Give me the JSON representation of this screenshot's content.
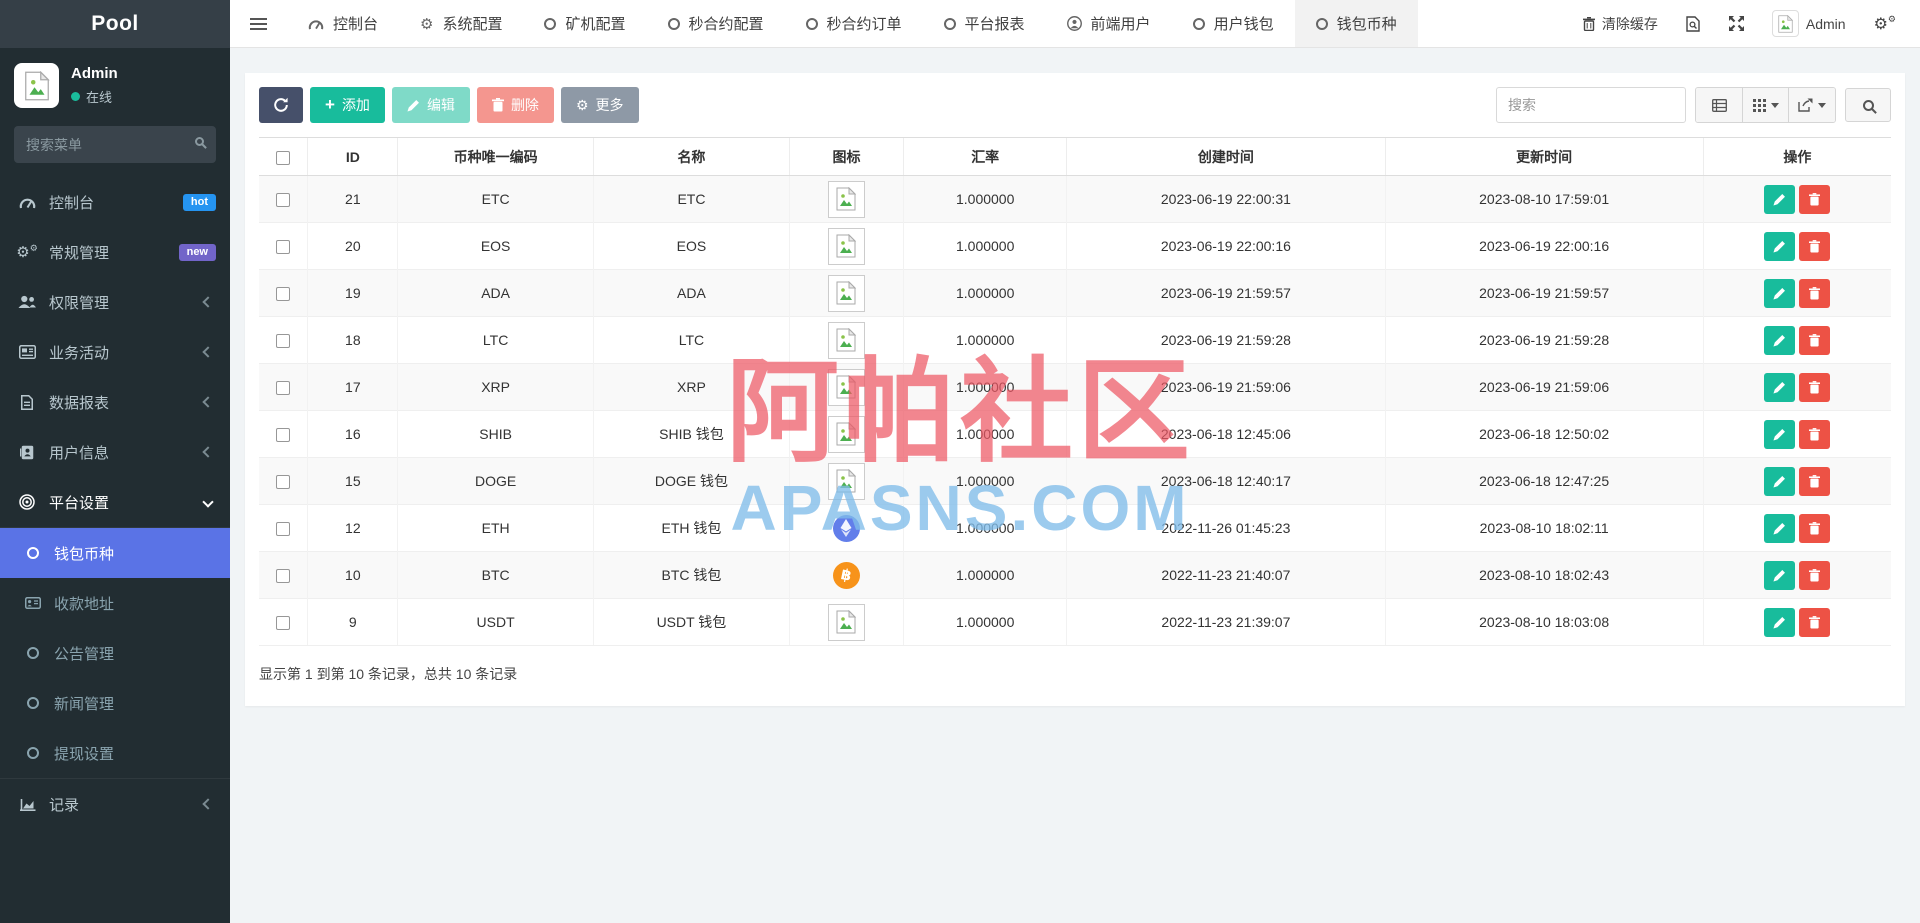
{
  "sidebar": {
    "logo": "Pool",
    "user": {
      "name": "Admin",
      "status": "在线"
    },
    "search_placeholder": "搜索菜单",
    "items": [
      {
        "label": "控制台",
        "badge": "hot"
      },
      {
        "label": "常规管理",
        "badge": "new"
      },
      {
        "label": "权限管理"
      },
      {
        "label": "业务活动"
      },
      {
        "label": "数据报表"
      },
      {
        "label": "用户信息"
      },
      {
        "label": "平台设置"
      },
      {
        "label": "记录"
      }
    ],
    "platform_submenu": [
      {
        "label": "钱包币种",
        "active": true
      },
      {
        "label": "收款地址"
      },
      {
        "label": "公告管理"
      },
      {
        "label": "新闻管理"
      },
      {
        "label": "提现设置"
      }
    ]
  },
  "topnav": {
    "tabs": [
      {
        "label": "控制台"
      },
      {
        "label": "系统配置"
      },
      {
        "label": "矿机配置"
      },
      {
        "label": "秒合约配置"
      },
      {
        "label": "秒合约订单"
      },
      {
        "label": "平台报表"
      },
      {
        "label": "前端用户"
      },
      {
        "label": "用户钱包"
      },
      {
        "label": "钱包币种",
        "active": true
      }
    ],
    "clear_cache": "清除缓存",
    "username": "Admin"
  },
  "toolbar": {
    "add": "添加",
    "edit": "编辑",
    "delete": "删除",
    "more": "更多",
    "search_placeholder": "搜索"
  },
  "table": {
    "headers": [
      "ID",
      "币种唯一编码",
      "名称",
      "图标",
      "汇率",
      "创建时间",
      "更新时间",
      "操作"
    ],
    "rows": [
      {
        "id": "21",
        "code": "ETC",
        "name": "ETC",
        "icon": "broken",
        "rate": "1.000000",
        "created": "2023-06-19 22:00:31",
        "updated": "2023-08-10 17:59:01"
      },
      {
        "id": "20",
        "code": "EOS",
        "name": "EOS",
        "icon": "broken",
        "rate": "1.000000",
        "created": "2023-06-19 22:00:16",
        "updated": "2023-06-19 22:00:16"
      },
      {
        "id": "19",
        "code": "ADA",
        "name": "ADA",
        "icon": "broken",
        "rate": "1.000000",
        "created": "2023-06-19 21:59:57",
        "updated": "2023-06-19 21:59:57"
      },
      {
        "id": "18",
        "code": "LTC",
        "name": "LTC",
        "icon": "broken",
        "rate": "1.000000",
        "created": "2023-06-19 21:59:28",
        "updated": "2023-06-19 21:59:28"
      },
      {
        "id": "17",
        "code": "XRP",
        "name": "XRP",
        "icon": "broken",
        "rate": "1.000000",
        "created": "2023-06-19 21:59:06",
        "updated": "2023-06-19 21:59:06"
      },
      {
        "id": "16",
        "code": "SHIB",
        "name": "SHIB 钱包",
        "icon": "broken",
        "rate": "1.000000",
        "created": "2023-06-18 12:45:06",
        "updated": "2023-06-18 12:50:02"
      },
      {
        "id": "15",
        "code": "DOGE",
        "name": "DOGE 钱包",
        "icon": "broken",
        "rate": "1.000000",
        "created": "2023-06-18 12:40:17",
        "updated": "2023-06-18 12:47:25"
      },
      {
        "id": "12",
        "code": "ETH",
        "name": "ETH 钱包",
        "icon": "eth",
        "rate": "1.000000",
        "created": "2022-11-26 01:45:23",
        "updated": "2023-08-10 18:02:11"
      },
      {
        "id": "10",
        "code": "BTC",
        "name": "BTC 钱包",
        "icon": "btc",
        "rate": "1.000000",
        "created": "2022-11-23 21:40:07",
        "updated": "2023-08-10 18:02:43"
      },
      {
        "id": "9",
        "code": "USDT",
        "name": "USDT 钱包",
        "icon": "broken",
        "rate": "1.000000",
        "created": "2022-11-23 21:39:07",
        "updated": "2023-08-10 18:03:08"
      }
    ]
  },
  "footer": {
    "summary": "显示第 1 到第 10 条记录，总共 10 条记录"
  },
  "watermark": {
    "line1": "阿帕社区",
    "line2": "APASNS.COM"
  },
  "colors": {
    "sidebar_bg": "#222d32",
    "active_menu": "#5a73e6",
    "hot_badge": "#2594f1",
    "new_badge": "#7265c9",
    "add_green": "#18bc9c",
    "delete_red": "#ed5245",
    "more_gray": "#8e99a6",
    "refresh_dark": "#46506a",
    "btc_orange": "#f7931a",
    "eth_blue": "#627eea",
    "online_green": "#1abc9c",
    "watermark_pink": "#ed5864",
    "watermark_blue": "#80bce9"
  }
}
